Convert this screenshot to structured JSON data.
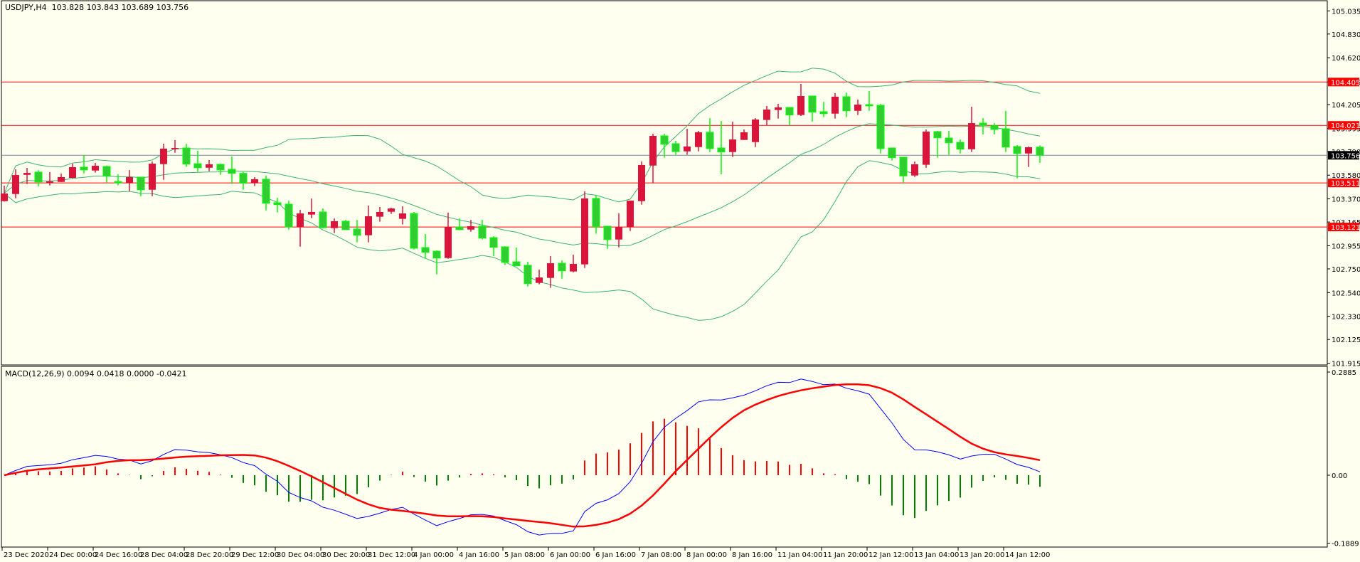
{
  "header": {
    "symbol": "USDJPY,H4",
    "ohlc": "103.828 103.843 103.689 103.756"
  },
  "macd_label": {
    "name": "MACD(12,26,9)",
    "values": "0.0094 0.0418 0.0000 -0.0421"
  },
  "colors": {
    "background": "#fffff0",
    "bull": "#dc143c",
    "bear": "#32cd32",
    "bear_outline": "#00ff00",
    "bands": "#3cb371",
    "level_line": "#ff0000",
    "price_line": "#778899",
    "macd_main": "#0000ff",
    "macd_signal": "#ff0000",
    "hist_pos": "#ff0000",
    "hist_neg": "#008000"
  },
  "chart_data": {
    "type": "candlestick",
    "title": "USDJPY,H4",
    "ylim": [
      101.915,
      105.035
    ],
    "price_ticks": [
      "105.035",
      "104.830",
      "104.620",
      "104.405",
      "104.205",
      "103.995",
      "103.790",
      "103.580",
      "103.370",
      "103.165",
      "102.955",
      "102.750",
      "102.540",
      "102.330",
      "102.125",
      "101.915"
    ],
    "time_labels": [
      {
        "bar": 0,
        "label": "23 Dec 2020"
      },
      {
        "bar": 4,
        "label": "24 Dec 00:00"
      },
      {
        "bar": 8,
        "label": "24 Dec 16:00"
      },
      {
        "bar": 12,
        "label": "28 Dec 04:00"
      },
      {
        "bar": 16,
        "label": "28 Dec 20:00"
      },
      {
        "bar": 20,
        "label": "29 Dec 12:00"
      },
      {
        "bar": 24,
        "label": "30 Dec 04:00"
      },
      {
        "bar": 28,
        "label": "30 Dec 20:00"
      },
      {
        "bar": 32,
        "label": "31 Dec 12:00"
      },
      {
        "bar": 36,
        "label": "4 Jan 00:00"
      },
      {
        "bar": 40,
        "label": "4 Jan 16:00"
      },
      {
        "bar": 44,
        "label": "5 Jan 08:00"
      },
      {
        "bar": 48,
        "label": "6 Jan 00:00"
      },
      {
        "bar": 52,
        "label": "6 Jan 16:00"
      },
      {
        "bar": 56,
        "label": "7 Jan 08:00"
      },
      {
        "bar": 60,
        "label": "8 Jan 00:00"
      },
      {
        "bar": 64,
        "label": "8 Jan 16:00"
      },
      {
        "bar": 68,
        "label": "11 Jan 04:00"
      },
      {
        "bar": 72,
        "label": "11 Jan 20:00"
      },
      {
        "bar": 76,
        "label": "12 Jan 12:00"
      },
      {
        "bar": 80,
        "label": "13 Jan 04:00"
      },
      {
        "bar": 84,
        "label": "13 Jan 20:00"
      },
      {
        "bar": 88,
        "label": "14 Jan 12:00"
      }
    ],
    "candles_format": [
      "open",
      "high",
      "low",
      "close"
    ],
    "candles": [
      [
        103.35,
        103.487,
        103.346,
        103.418
      ],
      [
        103.413,
        103.632,
        103.375,
        103.581
      ],
      [
        103.583,
        103.645,
        103.502,
        103.6
      ],
      [
        103.607,
        103.624,
        103.481,
        103.52
      ],
      [
        103.51,
        103.607,
        103.489,
        103.525
      ],
      [
        103.52,
        103.594,
        103.52,
        103.563
      ],
      [
        103.556,
        103.682,
        103.552,
        103.651
      ],
      [
        103.651,
        103.756,
        103.596,
        103.627
      ],
      [
        103.621,
        103.689,
        103.602,
        103.663
      ],
      [
        103.657,
        103.665,
        103.512,
        103.571
      ],
      [
        103.523,
        103.588,
        103.489,
        103.512
      ],
      [
        103.51,
        103.625,
        103.438,
        103.563
      ],
      [
        103.563,
        103.563,
        103.394,
        103.451
      ],
      [
        103.451,
        103.701,
        103.394,
        103.682
      ],
      [
        103.678,
        103.859,
        103.539,
        103.815
      ],
      [
        103.81,
        103.89,
        103.779,
        103.821
      ],
      [
        103.821,
        103.859,
        103.653,
        103.678
      ],
      [
        103.682,
        103.796,
        103.609,
        103.646
      ],
      [
        103.646,
        103.714,
        103.615,
        103.676
      ],
      [
        103.676,
        103.682,
        103.583,
        103.627
      ],
      [
        103.632,
        103.745,
        103.502,
        103.596
      ],
      [
        103.596,
        103.609,
        103.451,
        103.51
      ],
      [
        103.51,
        103.563,
        103.483,
        103.544
      ],
      [
        103.544,
        103.575,
        103.268,
        103.331
      ],
      [
        103.336,
        103.38,
        103.25,
        103.319
      ],
      [
        103.323,
        103.355,
        103.098,
        103.122
      ],
      [
        103.122,
        103.273,
        102.947,
        103.241
      ],
      [
        103.231,
        103.373,
        103.199,
        103.254
      ],
      [
        103.254,
        103.285,
        103.109,
        103.115
      ],
      [
        103.111,
        103.197,
        103.067,
        103.172
      ],
      [
        103.172,
        103.184,
        103.095,
        103.098
      ],
      [
        103.103,
        103.184,
        102.985,
        103.048
      ],
      [
        103.048,
        103.311,
        102.985,
        103.216
      ],
      [
        103.212,
        103.298,
        103.168,
        103.254
      ],
      [
        103.256,
        103.292,
        103.237,
        103.285
      ],
      [
        103.193,
        103.304,
        103.143,
        103.241
      ],
      [
        103.241,
        103.254,
        102.922,
        102.933
      ],
      [
        102.939,
        103.059,
        102.84,
        102.897
      ],
      [
        102.907,
        102.914,
        102.701,
        102.846
      ],
      [
        102.846,
        103.248,
        102.84,
        103.12
      ],
      [
        103.12,
        103.197,
        103.092,
        103.098
      ],
      [
        103.098,
        103.184,
        103.079,
        103.128
      ],
      [
        103.128,
        103.184,
        103.01,
        103.023
      ],
      [
        103.027,
        103.04,
        102.863,
        102.941
      ],
      [
        102.945,
        102.951,
        102.783,
        102.808
      ],
      [
        102.813,
        102.939,
        102.777,
        102.777
      ],
      [
        102.782,
        102.813,
        102.594,
        102.62
      ],
      [
        102.626,
        102.744,
        102.613,
        102.674
      ],
      [
        102.67,
        102.863,
        102.582,
        102.8
      ],
      [
        102.8,
        102.825,
        102.664,
        102.733
      ],
      [
        102.727,
        102.876,
        102.72,
        102.794
      ],
      [
        102.79,
        103.437,
        102.758,
        103.374
      ],
      [
        103.374,
        103.405,
        103.061,
        103.124
      ],
      [
        103.128,
        103.128,
        102.928,
        103.01
      ],
      [
        103.01,
        103.241,
        102.941,
        103.122
      ],
      [
        103.122,
        103.355,
        103.086,
        103.355
      ],
      [
        103.35,
        103.701,
        103.319,
        103.67
      ],
      [
        103.665,
        103.947,
        103.512,
        103.928
      ],
      [
        103.928,
        103.947,
        103.735,
        103.854
      ],
      [
        103.859,
        103.884,
        103.76,
        103.789
      ],
      [
        103.791,
        103.991,
        103.76,
        103.834
      ],
      [
        103.829,
        103.972,
        103.791,
        103.96
      ],
      [
        103.96,
        104.085,
        103.785,
        103.816
      ],
      [
        103.821,
        104.06,
        103.588,
        103.785
      ],
      [
        103.785,
        104.054,
        103.741,
        103.896
      ],
      [
        103.892,
        103.985,
        103.892,
        103.96
      ],
      [
        103.873,
        104.085,
        103.829,
        104.073
      ],
      [
        104.069,
        104.193,
        104.023,
        104.161
      ],
      [
        104.157,
        104.212,
        104.081,
        104.18
      ],
      [
        104.18,
        104.18,
        104.023,
        104.113
      ],
      [
        104.113,
        104.388,
        104.104,
        104.281
      ],
      [
        104.281,
        104.281,
        104.054,
        104.138
      ],
      [
        104.142,
        104.23,
        104.094,
        104.125
      ],
      [
        104.125,
        104.306,
        104.081,
        104.275
      ],
      [
        104.275,
        104.312,
        104.094,
        104.15
      ],
      [
        104.15,
        104.249,
        104.113,
        104.205
      ],
      [
        104.205,
        104.325,
        104.15,
        104.194
      ],
      [
        104.199,
        104.212,
        103.772,
        103.816
      ],
      [
        103.821,
        103.821,
        103.71,
        103.735
      ],
      [
        103.739,
        103.739,
        103.512,
        103.573
      ],
      [
        103.577,
        103.701,
        103.564,
        103.676
      ],
      [
        103.672,
        103.985,
        103.646,
        103.966
      ],
      [
        103.966,
        103.972,
        103.735,
        103.911
      ],
      [
        103.909,
        103.972,
        103.76,
        103.867
      ],
      [
        103.871,
        103.897,
        103.772,
        103.81
      ],
      [
        103.81,
        104.186,
        103.785,
        104.041
      ],
      [
        104.041,
        104.085,
        103.941,
        104.023
      ],
      [
        104.018,
        104.041,
        103.941,
        103.985
      ],
      [
        103.991,
        104.149,
        103.785,
        103.829
      ],
      [
        103.834,
        103.846,
        103.552,
        103.772
      ],
      [
        103.772,
        103.834,
        103.653,
        103.827
      ],
      [
        103.828,
        103.843,
        103.689,
        103.756
      ]
    ],
    "horizontal_lines": [
      {
        "price": 104.405,
        "label": "104.405"
      },
      {
        "price": 104.021,
        "label": "104.021"
      },
      {
        "price": 103.511,
        "label": "103.511"
      },
      {
        "price": 103.121,
        "label": "103.121"
      }
    ],
    "current_price": {
      "price": 103.756,
      "label": "103.756"
    },
    "bollinger": {
      "period": 20,
      "deviation": 2
    },
    "macd": {
      "fast": 12,
      "slow": 26,
      "signal": 9,
      "ylim": [
        -0.1889,
        0.2885
      ],
      "ticks": [
        {
          "value": 0.2885,
          "label": "0.2885"
        },
        {
          "value": 0,
          "label": "0.00"
        },
        {
          "value": -0.1889,
          "label": "-0.1889"
        }
      ]
    }
  }
}
